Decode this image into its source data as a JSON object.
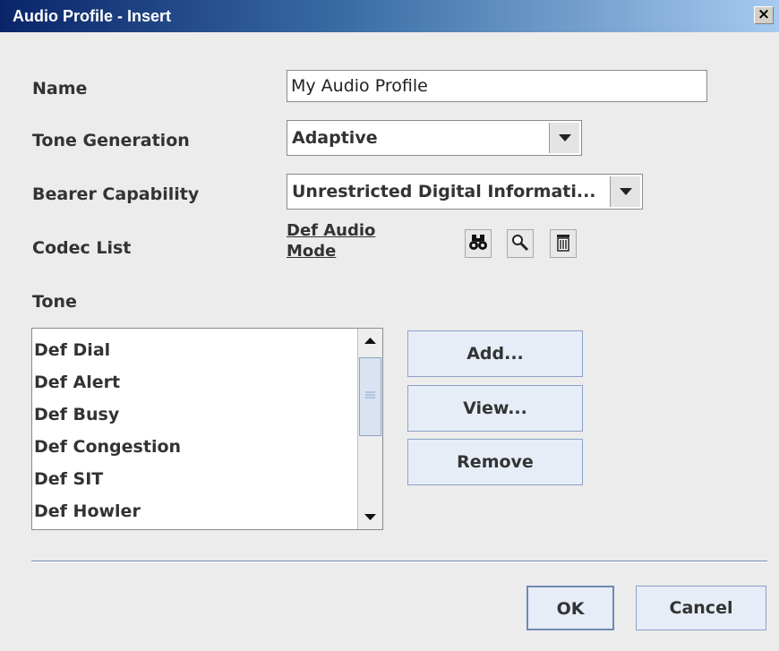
{
  "window": {
    "title": "Audio Profile - Insert",
    "close_glyph": "×"
  },
  "fields": {
    "name_label": "Name",
    "name_value": "My Audio Profile",
    "tone_generation_label": "Tone Generation",
    "tone_generation_value": "Adaptive",
    "bearer_capability_label": "Bearer Capability",
    "bearer_capability_value": "Unrestricted Digital Informati...",
    "codec_list_label": "Codec List",
    "codec_list_value_line1": "Def Audio",
    "codec_list_value_line2": "Mode"
  },
  "codec_actions": {
    "icons": [
      "binoculars-icon",
      "magnifier-icon",
      "trash-icon"
    ]
  },
  "tone": {
    "label": "Tone",
    "items": [
      "Def Dial",
      "Def Alert",
      "Def Busy",
      "Def Congestion",
      "Def SIT",
      "Def Howler"
    ],
    "buttons": {
      "add": "Add...",
      "view": "View...",
      "remove": "Remove"
    }
  },
  "footer": {
    "ok": "OK",
    "cancel": "Cancel"
  },
  "colors": {
    "title_gradient_start": "#0a246a",
    "title_gradient_end": "#a6caf0",
    "button_fill": "#e6edf7"
  }
}
